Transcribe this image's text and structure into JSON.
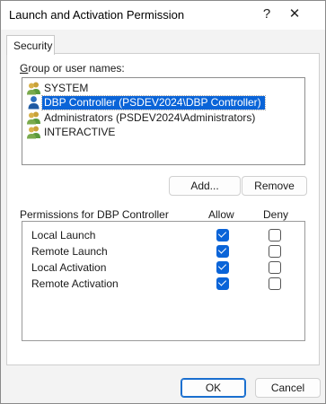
{
  "window": {
    "title": "Launch and Activation Permission",
    "help_glyph": "?",
    "close_glyph": "✕"
  },
  "tab": {
    "label": "Security"
  },
  "groups": {
    "label": "Group or user names:",
    "items": [
      {
        "name": "SYSTEM",
        "icon": "group-users-icon",
        "selected": false
      },
      {
        "name": "DBP Controller (PSDEV2024\\DBP Controller)",
        "icon": "user-icon",
        "selected": true
      },
      {
        "name": "Administrators (PSDEV2024\\Administrators)",
        "icon": "group-users-icon",
        "selected": false
      },
      {
        "name": "INTERACTIVE",
        "icon": "group-users-icon",
        "selected": false
      }
    ]
  },
  "buttons": {
    "add": "Add...",
    "remove": "Remove",
    "ok": "OK",
    "cancel": "Cancel"
  },
  "permissions": {
    "label": "Permissions for DBP Controller",
    "allow_header": "Allow",
    "deny_header": "Deny",
    "rows": [
      {
        "name": "Local Launch",
        "allow": true,
        "deny": false
      },
      {
        "name": "Remote Launch",
        "allow": true,
        "deny": false
      },
      {
        "name": "Local Activation",
        "allow": true,
        "deny": false
      },
      {
        "name": "Remote Activation",
        "allow": true,
        "deny": false
      }
    ]
  },
  "colors": {
    "accent": "#0a64d8",
    "dialog_bg": "#f3f3f3"
  }
}
